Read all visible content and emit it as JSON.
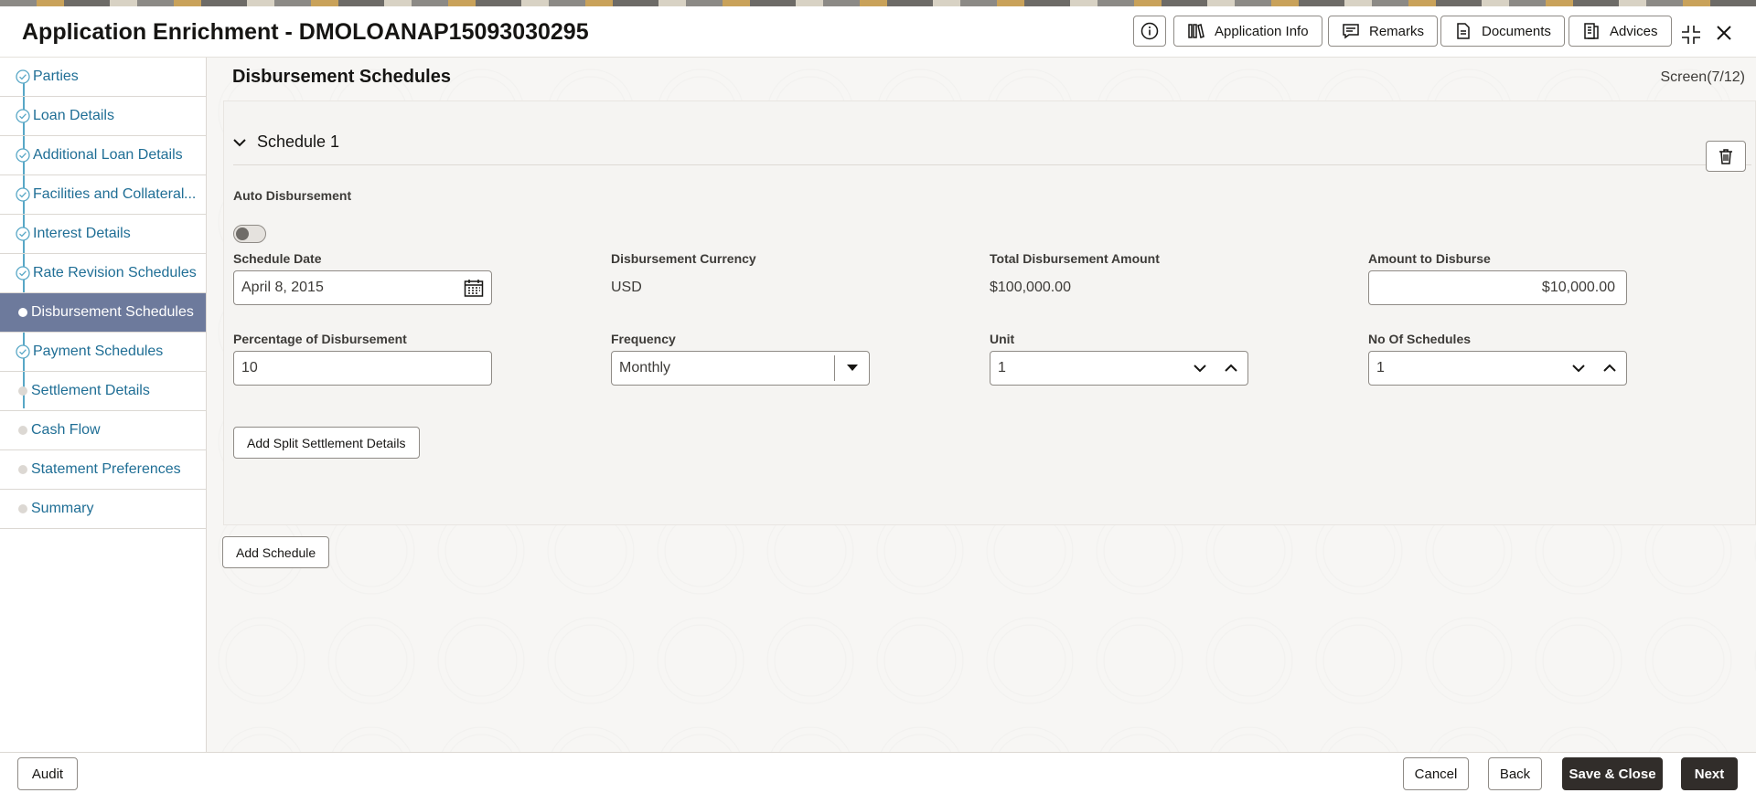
{
  "header": {
    "title": "Application Enrichment - DMOLOANAP15093030295",
    "buttons": {
      "application_info": "Application Info",
      "remarks": "Remarks",
      "documents": "Documents",
      "advices": "Advices"
    }
  },
  "sidebar": {
    "items": [
      {
        "label": "Parties",
        "state": "done"
      },
      {
        "label": "Loan Details",
        "state": "done"
      },
      {
        "label": "Additional Loan Details",
        "state": "done"
      },
      {
        "label": "Facilities and Collateral",
        "state": "done"
      },
      {
        "label": "Interest Details",
        "state": "done"
      },
      {
        "label": "Rate Revision Schedules",
        "state": "done"
      },
      {
        "label": "Disbursement Schedules",
        "state": "active"
      },
      {
        "label": "Payment Schedules",
        "state": "done"
      },
      {
        "label": "Settlement Details",
        "state": "pending"
      },
      {
        "label": "Cash Flow",
        "state": "pending"
      },
      {
        "label": "Statement Preferences",
        "state": "pending"
      },
      {
        "label": "Summary",
        "state": "pending"
      }
    ],
    "overflow_indicator": "..."
  },
  "main": {
    "page_title": "Disbursement Schedules",
    "screen_count": "Screen(7/12)",
    "schedule": {
      "title": "Schedule 1",
      "auto_disbursement_label": "Auto Disbursement",
      "auto_disbursement_on": false,
      "schedule_date_label": "Schedule Date",
      "schedule_date_value": "April 8, 2015",
      "currency_label": "Disbursement Currency",
      "currency_value": "USD",
      "total_amount_label": "Total Disbursement Amount",
      "total_amount_value": "$100,000.00",
      "amount_to_disburse_label": "Amount to Disburse",
      "amount_to_disburse_value": "$10,000.00",
      "percentage_label": "Percentage of Disbursement",
      "percentage_value": "10",
      "frequency_label": "Frequency",
      "frequency_value": "Monthly",
      "unit_label": "Unit",
      "unit_value": "1",
      "no_of_schedules_label": "No Of Schedules",
      "no_of_schedules_value": "1",
      "split_button": "Add Split Settlement Details"
    },
    "add_schedule_button": "Add Schedule"
  },
  "footer": {
    "audit": "Audit",
    "cancel": "Cancel",
    "back": "Back",
    "save_close": "Save & Close",
    "next": "Next"
  },
  "colors": {
    "active_nav": "#6d7a9c",
    "link": "#1f6e95",
    "primary_button": "#312d2a",
    "nav_line": "#58a7c6"
  }
}
